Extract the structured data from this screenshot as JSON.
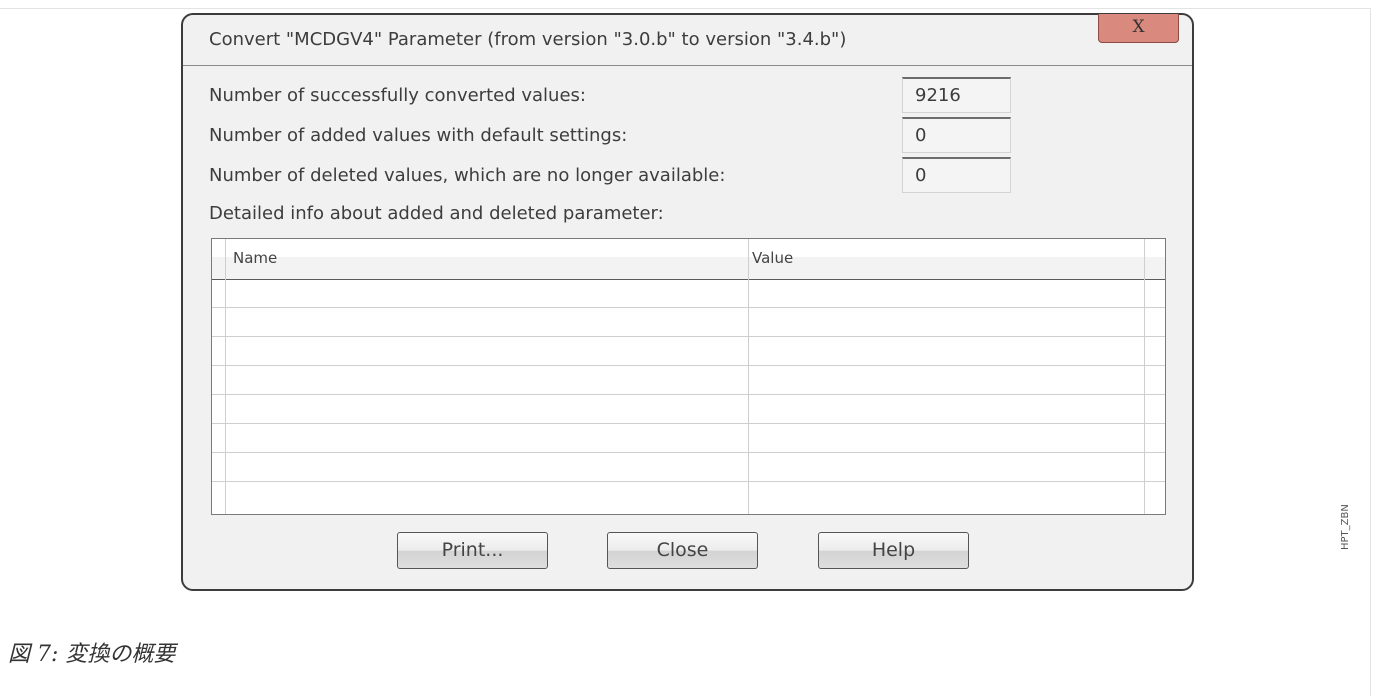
{
  "dialog": {
    "title": "Convert \"MCDGV4\" Parameter (from version \"3.0.b\" to version \"3.4.b\")",
    "close_glyph": "X",
    "stats": [
      {
        "label": "Number of successfully converted values:",
        "value": "9216"
      },
      {
        "label": "Number of added values with default settings:",
        "value": "0"
      },
      {
        "label": "Number of deleted values, which are no longer available:",
        "value": "0"
      }
    ],
    "details_label": "Detailed info about added and deleted parameter:",
    "table": {
      "columns": [
        "Name",
        "Value"
      ],
      "rows": []
    },
    "buttons": {
      "print": "Print...",
      "close": "Close",
      "help": "Help"
    }
  },
  "caption": "図 7: 変換の概要",
  "side_code": "HPT_ZBN"
}
